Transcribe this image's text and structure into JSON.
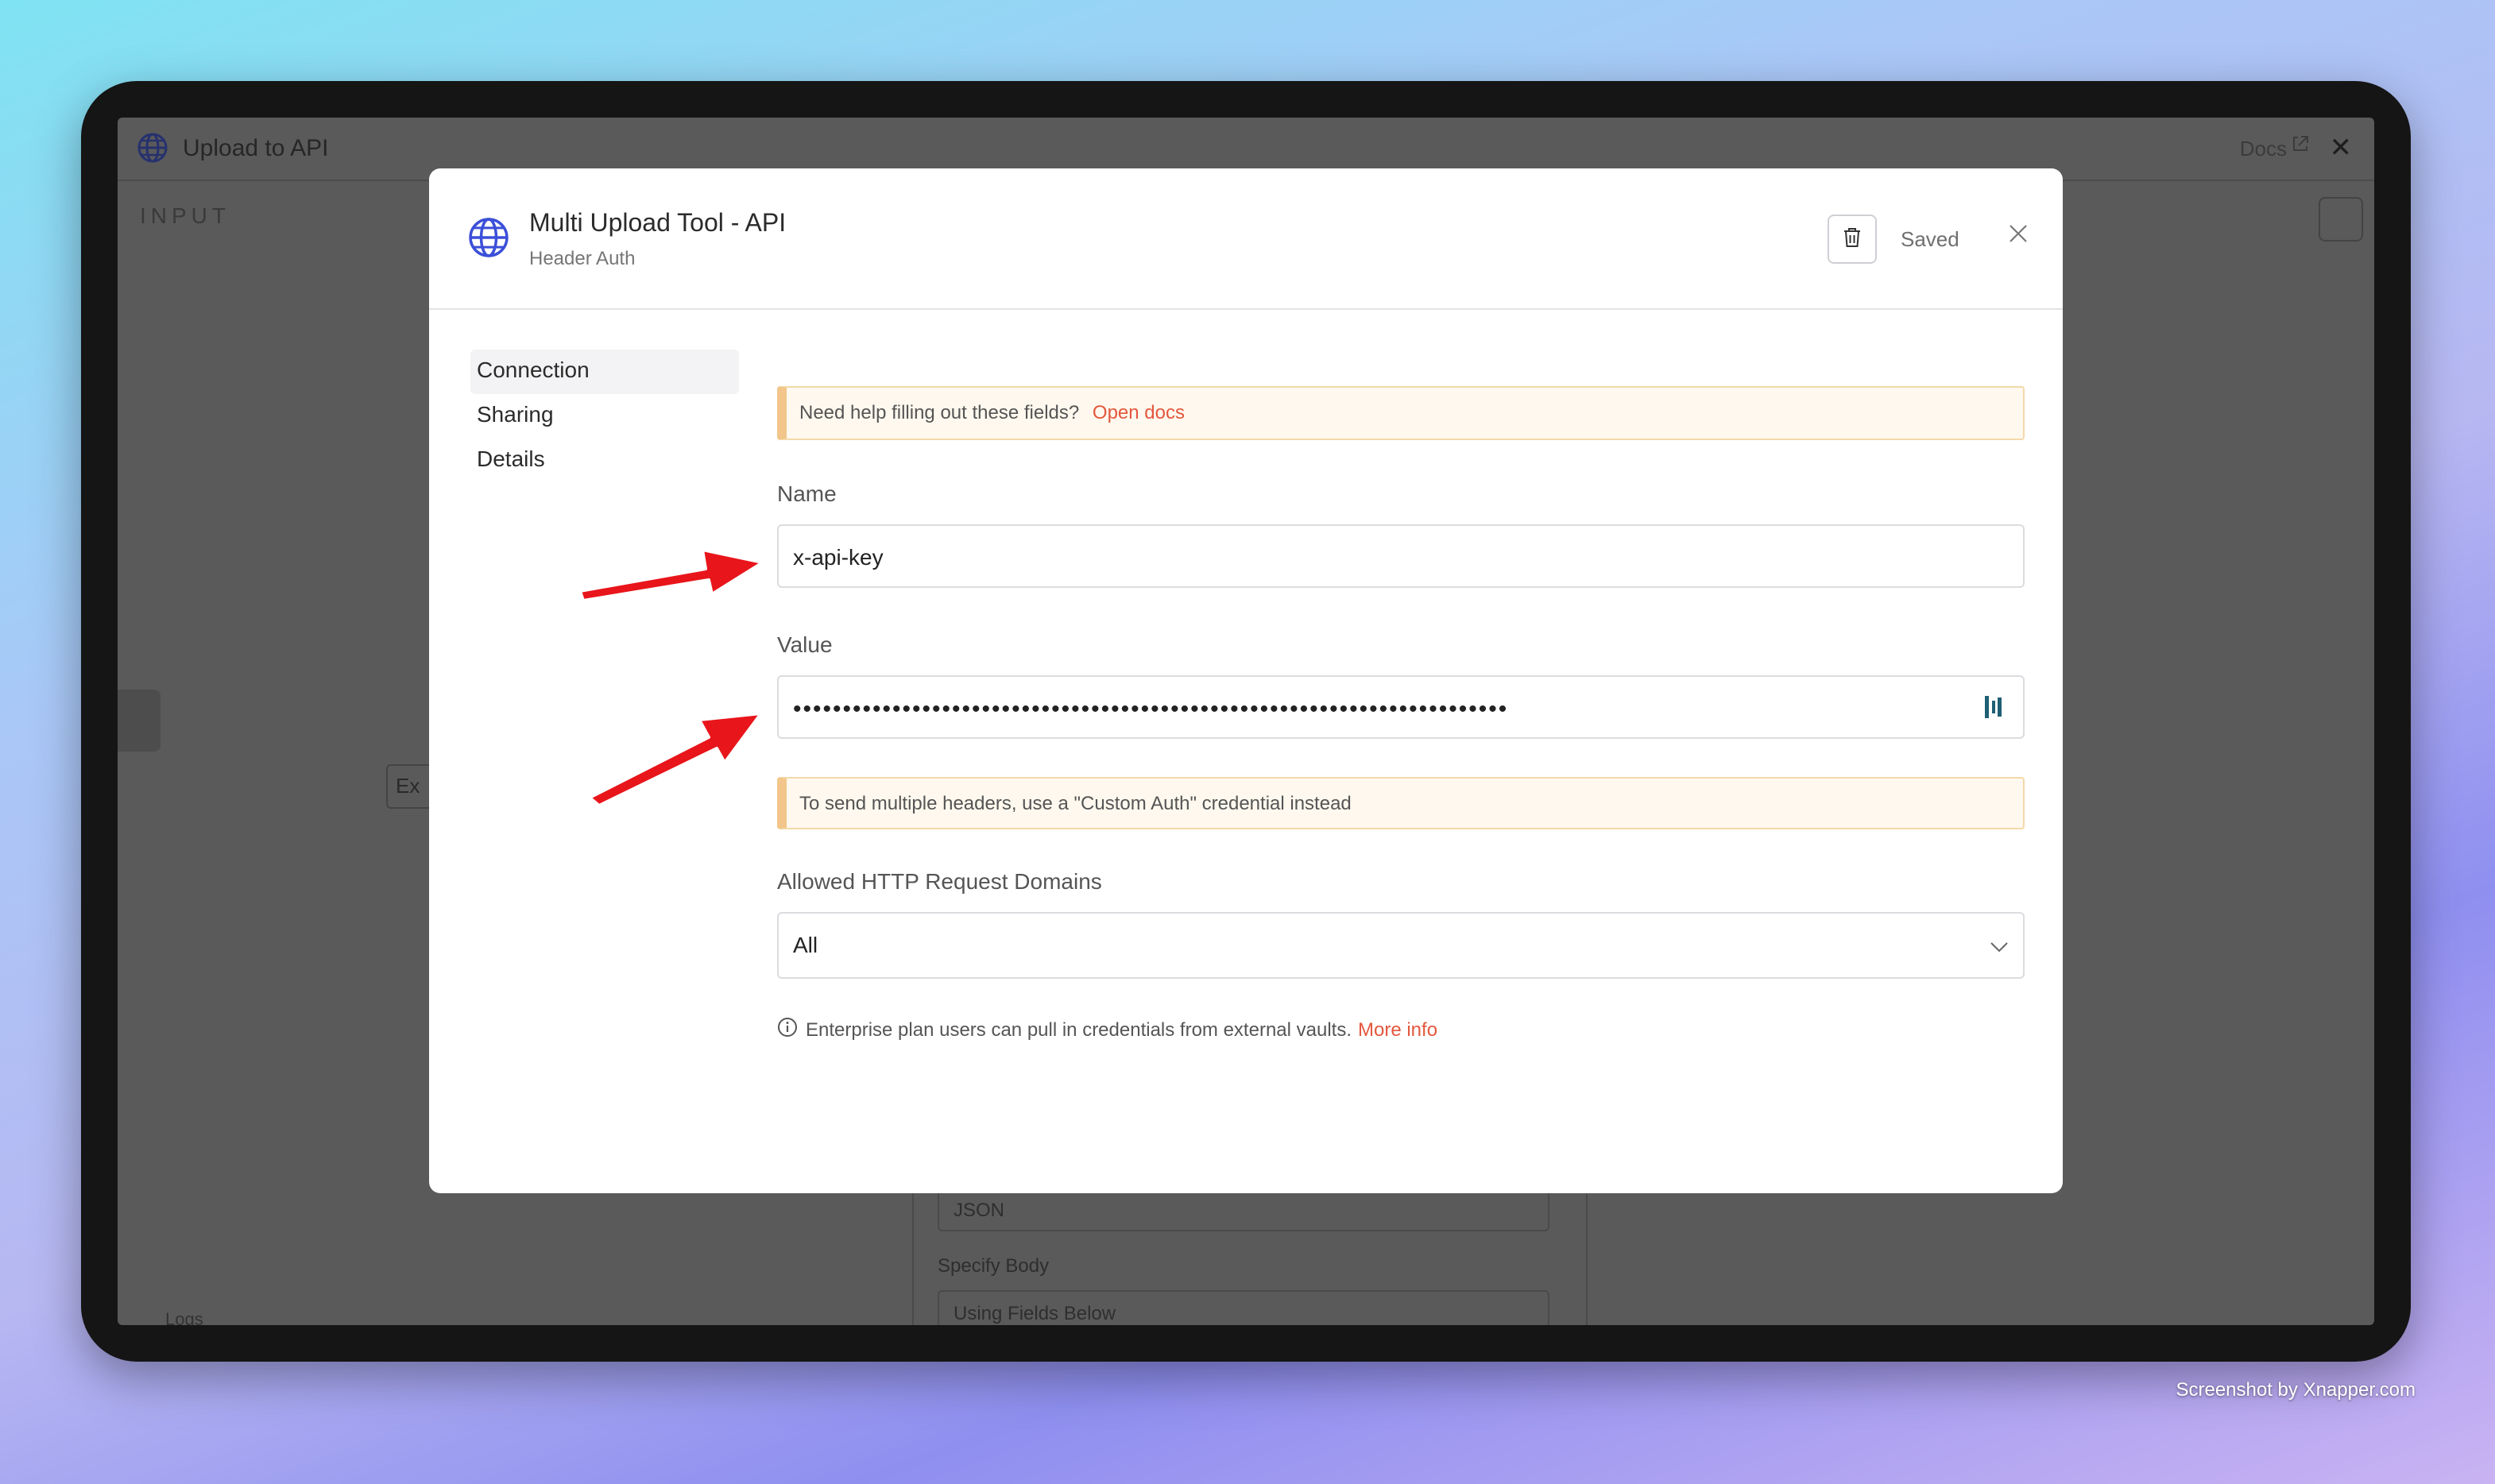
{
  "background_app": {
    "title": "Upload to API",
    "docs_label": "Docs",
    "input_label": "INPUT",
    "partial_button": "Ex",
    "body_format": "JSON",
    "specify_body_label": "Specify Body",
    "specify_body_value": "Using Fields Below",
    "logs_label": "Logs"
  },
  "modal": {
    "title": "Multi Upload Tool - API",
    "subtitle": "Header Auth",
    "saved_label": "Saved",
    "nav": [
      {
        "label": "Connection",
        "active": true
      },
      {
        "label": "Sharing",
        "active": false
      },
      {
        "label": "Details",
        "active": false
      }
    ],
    "help_notice": {
      "text": "Need help filling out these fields?",
      "link": "Open docs"
    },
    "name_field": {
      "label": "Name",
      "value": "x-api-key"
    },
    "value_field": {
      "label": "Value",
      "masked_value": "••••••••••••••••••••••••••••••••••••••••••••••••••••••••••••••••••••••••"
    },
    "multi_header_notice": "To send multiple headers, use a \"Custom Auth\" credential instead",
    "domains_field": {
      "label": "Allowed HTTP Request Domains",
      "value": "All"
    },
    "enterprise_info": {
      "text": "Enterprise plan users can pull in credentials from external vaults.",
      "link": "More info"
    }
  },
  "watermark": "Screenshot by Xnapper.com",
  "colors": {
    "accent_link": "#e4573d",
    "globe": "#3b4fd8",
    "notice_bg": "#fef8ee",
    "notice_border": "#f2c68a",
    "arrow": "#e8151b"
  }
}
